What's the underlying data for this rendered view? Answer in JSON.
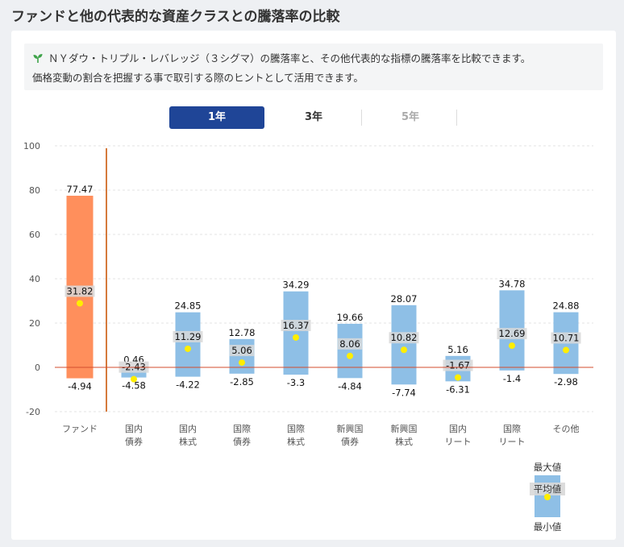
{
  "page_title": "ファンドと他の代表的な資産クラスとの騰落率の比較",
  "description": {
    "line1": "ＮＹダウ・トリプル・レバレッジ（３シグマ）の騰落率と、その他代表的な指標の騰落率を比較できます。",
    "line2": "価格変動の割合を把握する事で取引する際のヒントとして活用できます。",
    "icon": "sprout-icon"
  },
  "tabs": [
    {
      "label": "1年",
      "active": true
    },
    {
      "label": "3年",
      "active": false
    },
    {
      "label": "5年",
      "active": false
    }
  ],
  "colors": {
    "fund_bar": "#ff8f5c",
    "asset_bar": "#8ebfe6",
    "mean_dot": "#ffee00",
    "zero_line": "#d34c2e",
    "separator": "#d57a3c",
    "tab_active": "#1f4597"
  },
  "legend": {
    "max_label": "最大値",
    "mean_label": "平均値",
    "min_label": "最小値"
  },
  "chart_data": {
    "type": "bar",
    "subtype": "range-with-mean",
    "ylim": [
      -20,
      100
    ],
    "yticks": [
      -20,
      0,
      20,
      40,
      60,
      80,
      100
    ],
    "grid": true,
    "categories": [
      {
        "label": [
          "ファンド"
        ],
        "max": 77.47,
        "mean": 31.82,
        "min": -4.94,
        "fund": true
      },
      {
        "label": [
          "国内",
          "債券"
        ],
        "max": 0.46,
        "mean": -2.43,
        "min": -4.58
      },
      {
        "label": [
          "国内",
          "株式"
        ],
        "max": 24.85,
        "mean": 11.29,
        "min": -4.22
      },
      {
        "label": [
          "国際",
          "債券"
        ],
        "max": 12.78,
        "mean": 5.06,
        "min": -2.85
      },
      {
        "label": [
          "国際",
          "株式"
        ],
        "max": 34.29,
        "mean": 16.37,
        "min": -3.3
      },
      {
        "label": [
          "新興国",
          "債券"
        ],
        "max": 19.66,
        "mean": 8.06,
        "min": -4.84
      },
      {
        "label": [
          "新興国",
          "株式"
        ],
        "max": 28.07,
        "mean": 10.82,
        "min": -7.74
      },
      {
        "label": [
          "国内",
          "リート"
        ],
        "max": 5.16,
        "mean": -1.67,
        "min": -6.31
      },
      {
        "label": [
          "国際",
          "リート"
        ],
        "max": 34.78,
        "mean": 12.69,
        "min": -1.4
      },
      {
        "label": [
          "その他"
        ],
        "max": 24.88,
        "mean": 10.71,
        "min": -2.98
      }
    ]
  }
}
